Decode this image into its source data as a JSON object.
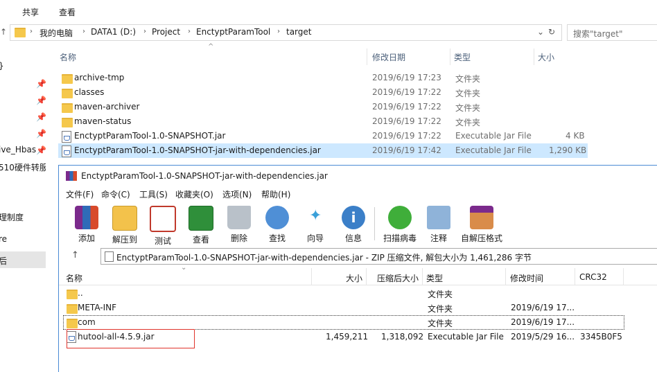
{
  "explorer": {
    "ribbon_tabs": [
      " ",
      "共享",
      "查看"
    ],
    "address": {
      "crumbs": [
        "我的电脑",
        "DATA1 (D:)",
        "Project",
        "EnctyptParamTool",
        "target"
      ],
      "search_placeholder": "搜索\"target\""
    },
    "nav_items": [
      "}",
      "ive_Hbas",
      "510硬件转服",
      "理制度",
      "re",
      "后"
    ],
    "columns": {
      "name": "名称",
      "date": "修改日期",
      "type": "类型",
      "size": "大小"
    },
    "files": [
      {
        "name": "archive-tmp",
        "date": "2019/6/19 17:23",
        "type": "文件夹",
        "size": "",
        "icon": "folder-icon"
      },
      {
        "name": "classes",
        "date": "2019/6/19 17:22",
        "type": "文件夹",
        "size": "",
        "icon": "folder-icon"
      },
      {
        "name": "maven-archiver",
        "date": "2019/6/19 17:22",
        "type": "文件夹",
        "size": "",
        "icon": "folder-icon"
      },
      {
        "name": "maven-status",
        "date": "2019/6/19 17:22",
        "type": "文件夹",
        "size": "",
        "icon": "folder-icon"
      },
      {
        "name": "EnctyptParamTool-1.0-SNAPSHOT.jar",
        "date": "2019/6/19 17:22",
        "type": "Executable Jar File",
        "size": "4 KB",
        "icon": "jar-icon"
      },
      {
        "name": "EnctyptParamTool-1.0-SNAPSHOT-jar-with-dependencies.jar",
        "date": "2019/6/19 17:42",
        "type": "Executable Jar File",
        "size": "1,290 KB",
        "icon": "jar-icon",
        "selected": true
      }
    ]
  },
  "winrar": {
    "title": "EnctyptParamTool-1.0-SNAPSHOT-jar-with-dependencies.jar",
    "menu": [
      "文件(F)",
      "命令(C)",
      "工具(S)",
      "收藏夹(O)",
      "选项(N)",
      "帮助(H)"
    ],
    "tools": [
      "添加",
      "解压到",
      "测试",
      "查看",
      "删除",
      "查找",
      "向导",
      "信息",
      "扫描病毒",
      "注释",
      "自解压格式"
    ],
    "path_text": "EnctyptParamTool-1.0-SNAPSHOT-jar-with-dependencies.jar - ZIP 压缩文件, 解包大小为 1,461,286 字节",
    "columns": {
      "name": "名称",
      "size": "大小",
      "packed": "压缩后大小",
      "type": "类型",
      "modified": "修改时间",
      "crc": "CRC32"
    },
    "entries": [
      {
        "name": "..",
        "size": "",
        "packed": "",
        "type": "文件夹",
        "modified": "",
        "crc": "",
        "icon": "folder-icon"
      },
      {
        "name": "META-INF",
        "size": "",
        "packed": "",
        "type": "文件夹",
        "modified": "2019/6/19 17...",
        "crc": "",
        "icon": "folder-icon"
      },
      {
        "name": "com",
        "size": "",
        "packed": "",
        "type": "文件夹",
        "modified": "2019/6/19 17...",
        "crc": "",
        "icon": "folder-icon"
      },
      {
        "name": "hutool-all-4.5.9.jar",
        "size": "1,459,211",
        "packed": "1,318,092",
        "type": "Executable Jar File",
        "modified": "2019/5/29 16...",
        "crc": "3345B0F5",
        "icon": "jar-icon"
      }
    ]
  }
}
